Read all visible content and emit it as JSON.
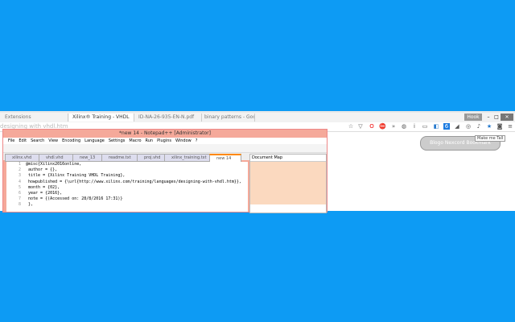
{
  "browser": {
    "tabs": [
      "Extensions",
      "Xilinx® Training - VHDL",
      "ID-NA-26-935-EN-N.pdf",
      "binary patterns - Google"
    ],
    "address_text": "designing with vhdl.htm",
    "window_controls": [
      "Hook",
      "–",
      "□",
      "✕"
    ]
  },
  "extensions": [
    "☆",
    "▽",
    "O",
    "⛔",
    "»",
    "◍",
    "i",
    "▭",
    "◧",
    "6",
    "◢",
    "◎",
    "♪",
    "★",
    "◙",
    "≡"
  ],
  "notepad": {
    "title": "*new 14 - Notepad++ [Administrator]",
    "menu": [
      "File",
      "Edit",
      "Search",
      "View",
      "Encoding",
      "Language",
      "Settings",
      "Macro",
      "Run",
      "Plugins",
      "Window",
      "?"
    ],
    "doc_tabs": [
      "xilinx.vhd",
      "vhdl.vhd",
      "new_13",
      "readme.txt",
      "proj.vhd",
      "xilinx_training.txt",
      "new 14"
    ],
    "lines": [
      "@misc{Xilinx2016online,",
      "  author = {},",
      "  title = {Xilinx Training  VHDL Training},",
      "  howpublished = {\\url{http://www.xilinx.com/training/languages/designing-with-vhdl.htm}},",
      "  month = {02},",
      "  year = {2016},",
      "  note = {(Accessed on: 28/8/2016 17:31)}",
      "  },"
    ],
    "document_map": "Document Map"
  },
  "right_panel": {
    "button": "Blogo Nexcord Bookmark",
    "tooltip": "Make me Tall"
  }
}
